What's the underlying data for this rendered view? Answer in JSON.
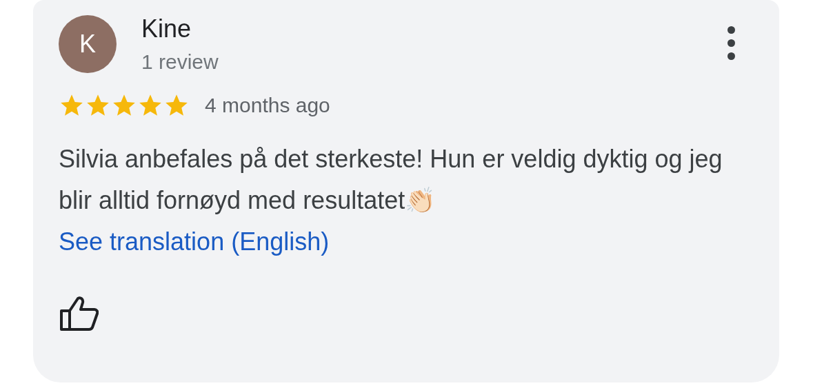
{
  "review": {
    "avatar_letter": "K",
    "author": "Kine",
    "review_count": "1 review",
    "stars": 5,
    "time": "4 months ago",
    "text": "Silvia anbefales på det sterkeste! Hun er veldig dyktig og jeg blir alltid fornøyd med resultatet👏🏻",
    "translation_link": "See translation (English)"
  }
}
